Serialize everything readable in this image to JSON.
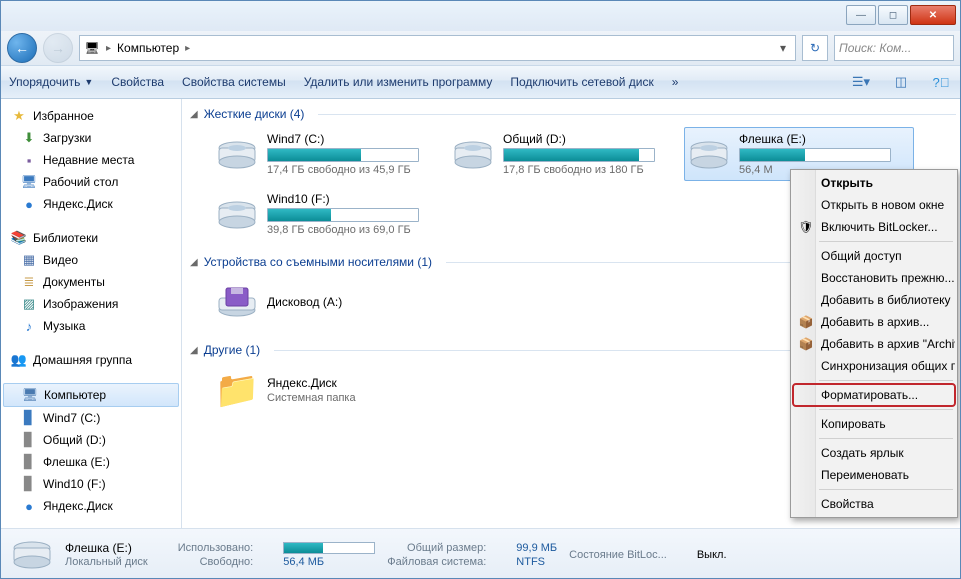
{
  "breadcrumb": {
    "root_icon": "🖥",
    "location": "Компьютер"
  },
  "search": {
    "placeholder": "Поиск: Ком..."
  },
  "toolbar": {
    "organize": "Упорядочить",
    "properties": "Свойства",
    "sys_properties": "Свойства системы",
    "uninstall": "Удалить или изменить программу",
    "map_drive": "Подключить сетевой диск",
    "more": "»"
  },
  "sidebar": {
    "favorites": {
      "label": "Избранное",
      "items": [
        {
          "icon": "⬇",
          "label": "Загрузки",
          "color": "#3f8e3a"
        },
        {
          "icon": "▪",
          "label": "Недавние места",
          "color": "#7a5c9e"
        },
        {
          "icon": "🖥",
          "label": "Рабочий стол",
          "color": "#3b7abf"
        },
        {
          "icon": "●",
          "label": "Яндекс.Диск",
          "color": "#2a7ad1"
        }
      ]
    },
    "libraries": {
      "label": "Библиотеки",
      "items": [
        {
          "icon": "▦",
          "label": "Видео",
          "color": "#4a6fa8"
        },
        {
          "icon": "≣",
          "label": "Документы",
          "color": "#c79b4a"
        },
        {
          "icon": "▨",
          "label": "Изображения",
          "color": "#3d8c8c"
        },
        {
          "icon": "♪",
          "label": "Музыка",
          "color": "#2a7ad1"
        }
      ]
    },
    "homegroup": {
      "label": "Домашняя группа",
      "icon": "👥"
    },
    "computer": {
      "label": "Компьютер",
      "icon": "🖥",
      "items": [
        {
          "icon": "▊",
          "label": "Wind7 (C:)",
          "color": "#3b7abf"
        },
        {
          "icon": "▊",
          "label": "Общий (D:)",
          "color": "#888"
        },
        {
          "icon": "▊",
          "label": "Флешка (E:)",
          "color": "#888"
        },
        {
          "icon": "▊",
          "label": "Wind10 (F:)",
          "color": "#888"
        },
        {
          "icon": "●",
          "label": "Яндекс.Диск",
          "color": "#2a7ad1"
        }
      ]
    }
  },
  "sections": {
    "hdd": {
      "title": "Жесткие диски (4)",
      "drives": [
        {
          "name": "Wind7 (C:)",
          "free": "17,4 ГБ свободно из 45,9 ГБ",
          "pct": 62
        },
        {
          "name": "Общий (D:)",
          "free": "17,8 ГБ свободно из 180 ГБ",
          "pct": 90
        },
        {
          "name": "Флешка (E:)",
          "free": "56,4 М",
          "pct": 43,
          "selected": true
        },
        {
          "name": "Wind10 (F:)",
          "free": "39,8 ГБ свободно из 69,0 ГБ",
          "pct": 42
        }
      ]
    },
    "removable": {
      "title": "Устройства со съемными носителями (1)",
      "items": [
        {
          "name": "Дисковод (A:)"
        }
      ]
    },
    "other": {
      "title": "Другие (1)",
      "items": [
        {
          "name": "Яндекс.Диск",
          "sub": "Системная папка"
        }
      ]
    }
  },
  "statusbar": {
    "name": "Флешка (E:)",
    "type": "Локальный диск",
    "used_lbl": "Использовано:",
    "free_lbl": "Свободно:",
    "free_val": "56,4 МБ",
    "total_lbl": "Общий размер:",
    "total_val": "99,9 МБ",
    "fs_lbl": "Файловая система:",
    "fs_val": "NTFS",
    "bl_lbl": "Состояние BitLoc...",
    "bl_val": "Выкл.",
    "used_pct": 43
  },
  "context_menu": {
    "items": [
      {
        "label": "Открыть",
        "bold": true
      },
      {
        "label": "Открыть в новом окне"
      },
      {
        "label": "Включить BitLocker...",
        "icon": "🛡"
      },
      {
        "sep": true
      },
      {
        "label": "Общий доступ"
      },
      {
        "label": "Восстановить прежню..."
      },
      {
        "label": "Добавить в библиотеку"
      },
      {
        "label": "Добавить в архив...",
        "icon": "📦"
      },
      {
        "label": "Добавить в архив \"Archiv",
        "icon": "📦"
      },
      {
        "label": "Синхронизация общих п"
      },
      {
        "sep": true
      },
      {
        "label": "Форматировать...",
        "highlight": true
      },
      {
        "sep": true
      },
      {
        "label": "Копировать"
      },
      {
        "sep": true
      },
      {
        "label": "Создать ярлык"
      },
      {
        "label": "Переименовать"
      },
      {
        "sep": true
      },
      {
        "label": "Свойства"
      }
    ]
  }
}
